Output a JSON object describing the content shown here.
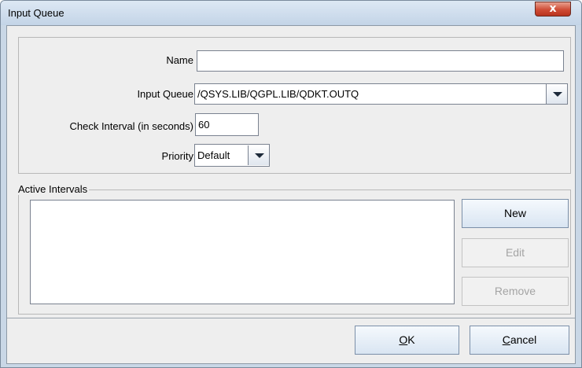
{
  "window": {
    "title": "Input Queue",
    "close_glyph": "x"
  },
  "form": {
    "name": {
      "label": "Name",
      "value": ""
    },
    "input_queue": {
      "label": "Input Queue",
      "value": "/QSYS.LIB/QGPL.LIB/QDKT.OUTQ"
    },
    "check_interval": {
      "label": "Check Interval (in seconds)",
      "value": "60"
    },
    "priority": {
      "label": "Priority",
      "value": "Default"
    }
  },
  "active_intervals": {
    "title": "Active Intervals",
    "items": [],
    "buttons": {
      "new": "New",
      "edit": "Edit",
      "remove": "Remove"
    }
  },
  "footer": {
    "ok_mnemonic": "O",
    "ok_rest": "K",
    "cancel_mnemonic": "C",
    "cancel_rest": "ancel"
  }
}
